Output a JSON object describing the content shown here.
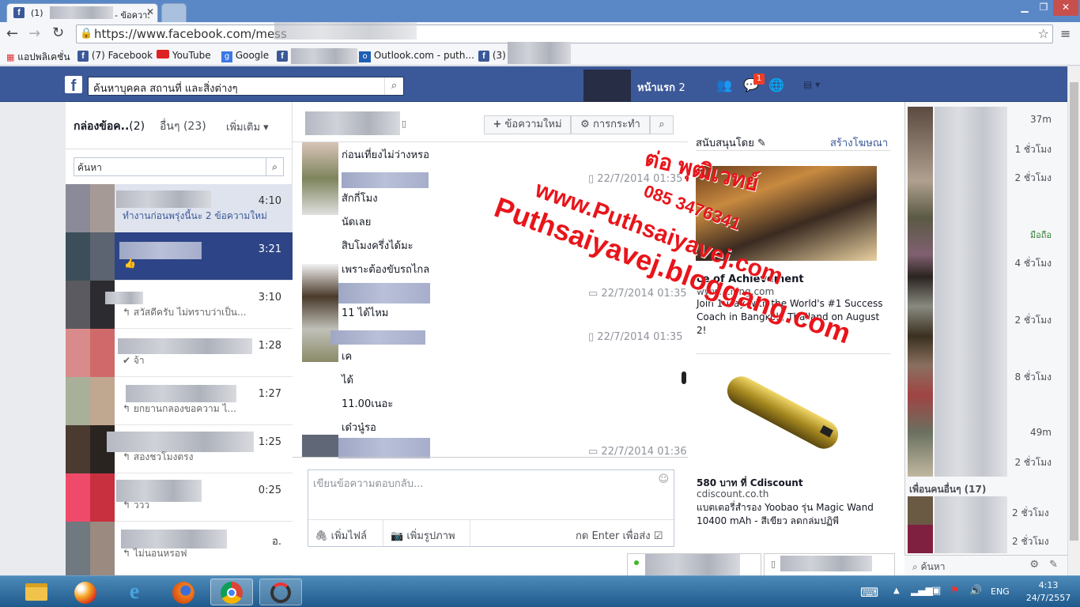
{
  "browser": {
    "tab_title": "(1)",
    "tab_title_suffix": "- ข้อควา:",
    "url": "https://www.facebook.com/mess",
    "bookmarks": [
      {
        "label": "แอปพลิเคชั่น",
        "icon": "apps-grid-icon"
      },
      {
        "label": "(7) Facebook",
        "icon": "facebook-icon"
      },
      {
        "label": "YouTube",
        "icon": "youtube-icon"
      },
      {
        "label": "Google",
        "icon": "google-icon"
      },
      {
        "label": "Outlook.com - puth...",
        "icon": "outlook-icon"
      },
      {
        "label": "(3)",
        "icon": "facebook-icon"
      }
    ]
  },
  "fb_header": {
    "search_placeholder": "ค้นหาบุคคล สถานที่ และสิ่งต่างๆ",
    "home_label": "หน้าแรก",
    "home_count": "2",
    "messages_badge": "1"
  },
  "inbox": {
    "tab_inbox": "กล่องข้อค..",
    "tab_inbox_count": "(2)",
    "tab_other": "อื่นๆ",
    "tab_other_count": "(23)",
    "more_label": "เพิ่มเติม",
    "search_placeholder": "ค้นหา",
    "conversations": [
      {
        "time": "4:10",
        "snippet": "ทำงานก่อนพรุ่งนี้นะ 2 ข้อความใหม่"
      },
      {
        "time": "3:21",
        "snippet": ""
      },
      {
        "time": "3:10",
        "snippet": "↰ สวัสดีครับ ไม่ทราบว่าเป็น..."
      },
      {
        "time": "1:28",
        "snippet": "✔ จ้า"
      },
      {
        "time": "1:27",
        "snippet": "↰ ยกยานกลองขอความ ไ..."
      },
      {
        "time": "1:25",
        "snippet": "↰ สองชวโมงตรง"
      },
      {
        "time": "0:25",
        "snippet": "↰ ววว"
      },
      {
        "time": "อ.",
        "snippet": "↰ ไม่นอนหรอฟ"
      }
    ]
  },
  "conversation": {
    "new_message_label": "ข้อความใหม่",
    "actions_label": "การกระทำ",
    "messages": [
      {
        "text": "ก่อนเที่ยงไม่ว่างหรอ"
      },
      {
        "text": "สักกี่โมง",
        "stamp": "22/7/2014 01:35"
      },
      {
        "text": "นัดเลย"
      },
      {
        "text": "สิบโมงครึ่งได้มะ"
      },
      {
        "text": "เพราะต้องขับรถไกล"
      },
      {
        "text": "11 ได้ไหม",
        "stamp": "22/7/2014 01:35"
      },
      {
        "text": "เค",
        "stamp": "22/7/2014 01:35"
      },
      {
        "text": "ได้"
      },
      {
        "text": "11.00เนอะ"
      },
      {
        "text": "เด๋วนู๋รอ"
      },
      {
        "text": "",
        "stamp": "22/7/2014 01:36"
      }
    ],
    "reply_placeholder": "เขียนข้อความตอบกลับ...",
    "attach_file": "เพิ่มไฟล์",
    "attach_photo": "เพิ่มรูปภาพ",
    "press_enter": "กด Enter เพื่อส่ง"
  },
  "ads": {
    "sponsored": "สนับสนุนโดย",
    "create_ad": "สร้างโฆษณา",
    "ad1_title": "ce of Achievement",
    "ad1_url": "www.       ching.com",
    "ad1_body": "Join 1-Day     with the World's #1 Success Coach in Bangkok, Thailand on August 2!",
    "ad2_title": "580 บาท ที่ Cdiscount",
    "ad2_url": "cdiscount.co.th",
    "ad2_body": "แบตเตอรี่สำรอง Yoobao รุ่น Magic Wand 10400 mAh - สีเขียว ลดกล่มปฏิพี"
  },
  "watermark": {
    "line1": "ต่อ พุฒิเวทย์",
    "line2": "085 3476341",
    "line3": "www.Puthsaiyavej.com",
    "line4": "Puthsaiyavej.bloggang.com"
  },
  "chat_sidebar": {
    "times": [
      "37m",
      "1 ชั่วโมง",
      "2 ชั่วโมง",
      "",
      "",
      "มือถือ",
      "4 ชั่วโมง",
      "",
      "2 ชั่วโมง",
      "",
      "8 ชั่วโมง",
      "",
      "49m",
      "2 ชั่วโมง"
    ],
    "other_friends": "เพื่อนคนอื่นๆ (17)",
    "other_times": [
      "2 ชั่วโมง",
      "2 ชั่วโมง"
    ],
    "search_placeholder": "ค้นหา"
  },
  "taskbar": {
    "language": "ENG",
    "time": "4:13",
    "date": "24/7/2557"
  },
  "colors": {
    "fb_blue": "#3b5998",
    "chrome_blue": "#5a88c6",
    "watermark_red": "#e8151b"
  }
}
